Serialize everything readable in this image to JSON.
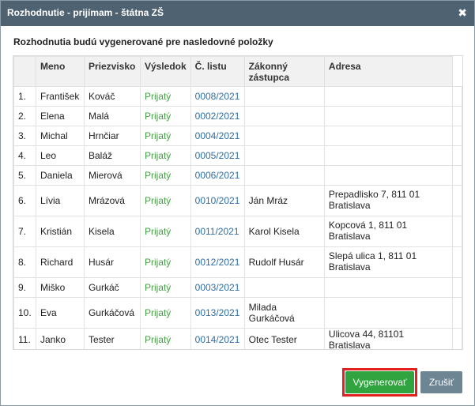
{
  "dialog": {
    "title": "Rozhodnutie - prijímam - štátna ZŠ",
    "close_glyph": "✖",
    "heading": "Rozhodnutia budú vygenerované pre nasledovné položky"
  },
  "table": {
    "columns": [
      "",
      "Meno",
      "Priezvisko",
      "Výsledok",
      "Č. listu",
      "Zákonný zástupca",
      "Adresa"
    ],
    "rows": [
      {
        "num": "1.",
        "first": "František",
        "last": "Kováč",
        "result": "Prijatý",
        "list_no": "0008/2021",
        "guardian": "",
        "address": ""
      },
      {
        "num": "2.",
        "first": "Elena",
        "last": "Malá",
        "result": "Prijatý",
        "list_no": "0002/2021",
        "guardian": "",
        "address": ""
      },
      {
        "num": "3.",
        "first": "Michal",
        "last": "Hrnčiar",
        "result": "Prijatý",
        "list_no": "0004/2021",
        "guardian": "",
        "address": ""
      },
      {
        "num": "4.",
        "first": "Leo",
        "last": "Baláž",
        "result": "Prijatý",
        "list_no": "0005/2021",
        "guardian": "",
        "address": ""
      },
      {
        "num": "5.",
        "first": "Daniela",
        "last": "Mierová",
        "result": "Prijatý",
        "list_no": "0006/2021",
        "guardian": "",
        "address": ""
      },
      {
        "num": "6.",
        "first": "Lívia",
        "last": "Mrázová",
        "result": "Prijatý",
        "list_no": "0010/2021",
        "guardian": "Ján Mráz",
        "address": "Prepadlisko 7, 811 01 Bratislava"
      },
      {
        "num": "7.",
        "first": "Kristián",
        "last": "Kisela",
        "result": "Prijatý",
        "list_no": "0011/2021",
        "guardian": "Karol Kisela",
        "address": "Kopcová 1, 811 01 Bratislava"
      },
      {
        "num": "8.",
        "first": "Richard",
        "last": "Husár",
        "result": "Prijatý",
        "list_no": "0012/2021",
        "guardian": "Rudolf Husár",
        "address": "Slepá ulica 1, 811 01 Bratislava"
      },
      {
        "num": "9.",
        "first": "Miško",
        "last": "Gurkáč",
        "result": "Prijatý",
        "list_no": "0003/2021",
        "guardian": "",
        "address": ""
      },
      {
        "num": "10.",
        "first": "Eva",
        "last": "Gurkáčová",
        "result": "Prijatý",
        "list_no": "0013/2021",
        "guardian": "Milada Gurkáčová",
        "address": ""
      },
      {
        "num": "11.",
        "first": "Janko",
        "last": "Tester",
        "result": "Prijatý",
        "list_no": "0014/2021",
        "guardian": "Otec Tester",
        "address": "Ulicova 44, 81101 Bratislava"
      }
    ]
  },
  "buttons": {
    "generate": "Vygenerovať",
    "cancel": "Zrušiť"
  },
  "colors": {
    "titlebar": "#4f6272",
    "result_green": "#44a044",
    "link_blue": "#2f6ea5",
    "generate_green": "#2fa43f",
    "cancel_gray": "#6e8593",
    "highlight_red": "#e22020"
  }
}
